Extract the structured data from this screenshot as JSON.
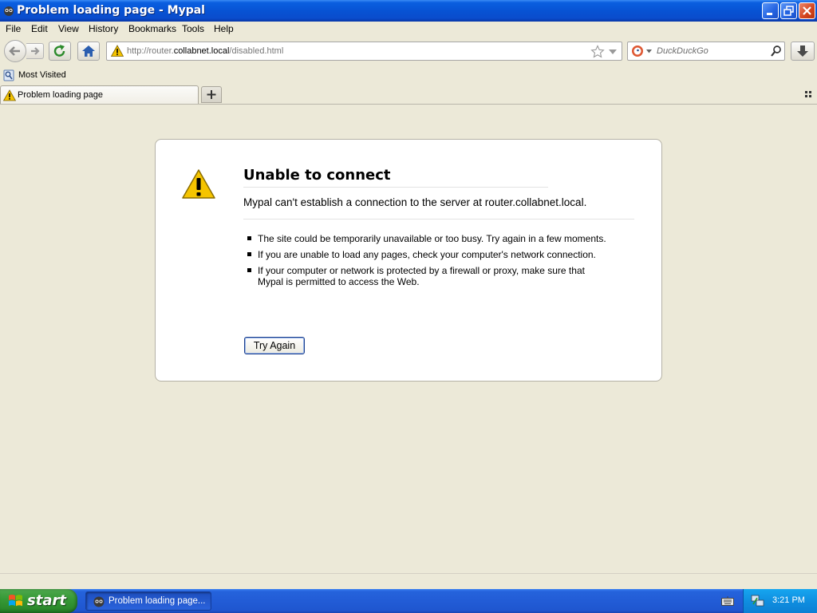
{
  "window": {
    "title": "Problem loading page - Mypal"
  },
  "menu": {
    "items": [
      "File",
      "Edit",
      "View",
      "History",
      "Bookmarks",
      "Tools",
      "Help"
    ]
  },
  "navbar": {
    "url_prefix": "http://router.",
    "url_host": "collabnet.local",
    "url_path": "/disabled.html",
    "search_placeholder": "DuckDuckGo"
  },
  "bookmarks": {
    "most_visited": "Most Visited"
  },
  "tabs": [
    {
      "label": "Problem loading page"
    }
  ],
  "error": {
    "title": "Unable to connect",
    "short_desc": "Mypal can't establish a connection to the server at router.collabnet.local.",
    "bullets": [
      "The site could be temporarily unavailable or too busy. Try again in a few moments.",
      "If you are unable to load any pages, check your computer's network connection.",
      "If your computer or network is protected by a firewall or proxy, make sure that Mypal is permitted to access the Web."
    ],
    "try_again_label": "Try Again"
  },
  "taskbar": {
    "start_label": "start",
    "task_label": "Problem loading page...",
    "clock": "3:21 PM"
  },
  "colors": {
    "titlebar_blue": "#0753d4",
    "taskbar_blue": "#225cd6",
    "start_green": "#379a37",
    "chrome_bg": "#ece9d8",
    "warning_yellow": "#f5c400"
  }
}
